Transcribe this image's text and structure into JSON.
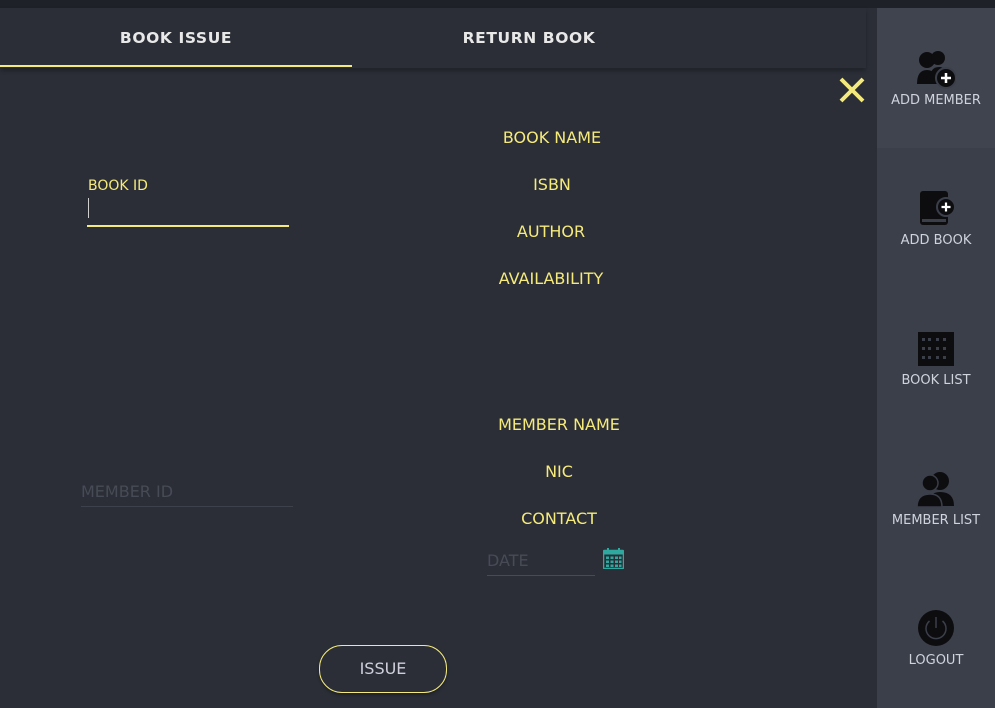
{
  "tabs": [
    {
      "label": "BOOK ISSUE",
      "active": true
    },
    {
      "label": "RETURN BOOK",
      "active": false
    }
  ],
  "colors": {
    "accent": "#f3e97c",
    "background": "#2b2e37",
    "sidebar": "#3b3f4a",
    "calendar_icon": "#2fa9a0"
  },
  "book": {
    "id_label": "BOOK ID",
    "id_value": "",
    "info_labels": [
      "BOOK NAME",
      "ISBN",
      "AUTHOR",
      "AVAILABILITY"
    ]
  },
  "member": {
    "id_placeholder": "MEMBER ID",
    "info_labels": [
      "MEMBER NAME",
      "NIC",
      "CONTACT"
    ]
  },
  "date": {
    "placeholder": "DATE"
  },
  "issue_button": "ISSUE",
  "sidebar": {
    "items": [
      {
        "label": "ADD MEMBER",
        "icon": "add-member-icon"
      },
      {
        "label": "ADD BOOK",
        "icon": "add-book-icon"
      },
      {
        "label": "BOOK LIST",
        "icon": "book-list-icon"
      },
      {
        "label": "MEMBER LIST",
        "icon": "member-list-icon"
      },
      {
        "label": "LOGOUT",
        "icon": "power-icon"
      }
    ]
  }
}
